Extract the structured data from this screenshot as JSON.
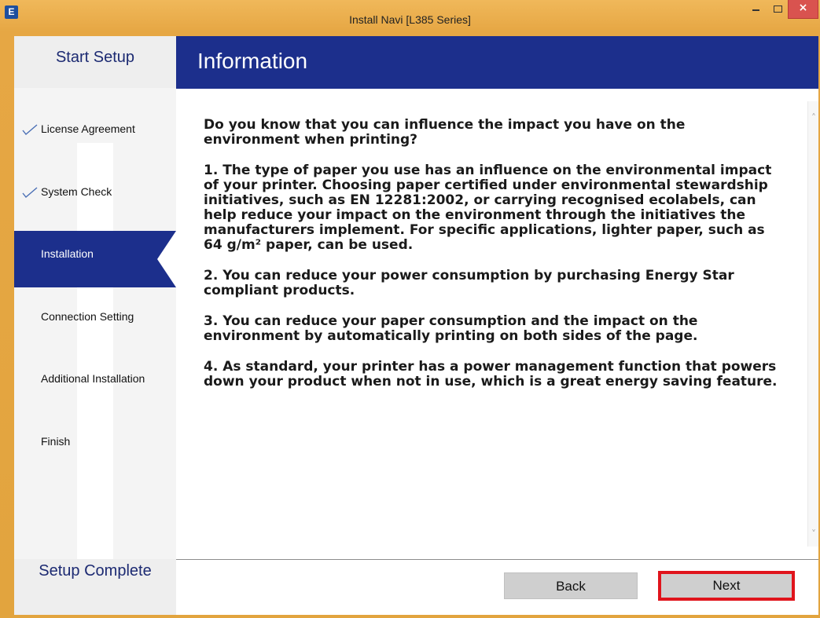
{
  "window": {
    "title": "Install Navi [L385 Series]",
    "app_icon_letter": "E",
    "accent_color": "#1c2f8c",
    "frame_color": "#e2a43e",
    "highlight_color": "#e0141c"
  },
  "sidebar": {
    "header": "Start Setup",
    "footer": "Setup Complete",
    "steps": [
      {
        "label": "License Agreement",
        "status": "done"
      },
      {
        "label": "System Check",
        "status": "done"
      },
      {
        "label": "Installation",
        "status": "active"
      },
      {
        "label": "Connection Setting",
        "status": "pending"
      },
      {
        "label": "Additional Installation",
        "status": "pending"
      },
      {
        "label": "Finish",
        "status": "pending"
      }
    ]
  },
  "main": {
    "title": "Information",
    "paragraphs": [
      "Do you know that you can influence the impact you have on the environment when printing?",
      "1. The type of paper you use has an influence on the environmental impact of your printer. Choosing paper certified under environmental stewardship initiatives, such as EN 12281:2002, or carrying recognised ecolabels, can help reduce your impact on the environment through the initiatives the manufacturers implement. For specific applications, lighter paper, such as 64 g/m² paper, can be used.",
      "2. You can reduce your power consumption by purchasing Energy Star compliant products.",
      "3. You can reduce your paper consumption and the impact on the environment by automatically printing on both sides of the page.",
      "4. As standard, your printer has a power management function that powers down your product when not in use, which is a great energy saving feature."
    ]
  },
  "footer": {
    "back_label": "Back",
    "next_label": "Next"
  }
}
